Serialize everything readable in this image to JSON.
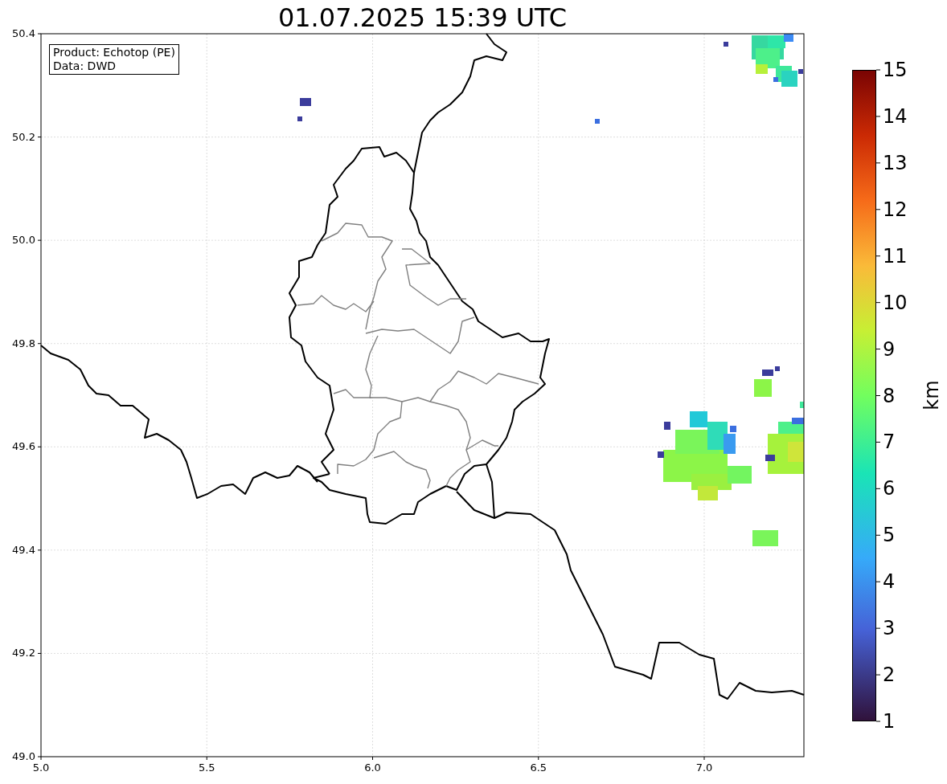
{
  "title": "01.07.2025 15:39 UTC",
  "info_box": [
    "Product: Echotop (PE)",
    "Data: DWD"
  ],
  "x_ticks": [
    "5.0",
    "5.5",
    "6.0",
    "6.5",
    "7.0"
  ],
  "y_ticks": [
    "50.4",
    "50.2",
    "50.0",
    "49.8",
    "49.6",
    "49.4",
    "49.2",
    "49.0"
  ],
  "colorbar": {
    "label": "km",
    "ticks": [
      "15",
      "14",
      "13",
      "12",
      "11",
      "10",
      "9",
      "8",
      "7",
      "6",
      "5",
      "4",
      "3",
      "2",
      "1"
    ]
  }
}
